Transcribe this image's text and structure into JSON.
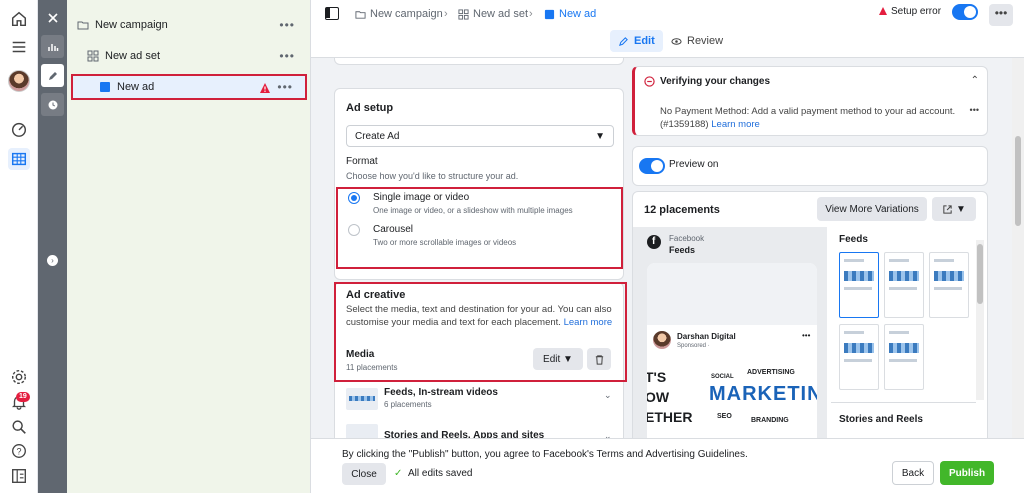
{
  "rail": {
    "icons": [
      "home-icon",
      "menu-icon",
      "avatar",
      "dashboard-icon",
      "table-icon",
      "settings-icon",
      "bell-icon",
      "search-icon",
      "help-icon",
      "panel-icon"
    ],
    "notification_count": "19"
  },
  "tree": {
    "campaign": "New campaign",
    "adset": "New ad set",
    "ad": "New ad",
    "more": "•••"
  },
  "header": {
    "breadcrumb": [
      "New campaign",
      "New ad set",
      "New ad"
    ],
    "edit_label": "Edit",
    "review_label": "Review",
    "setup_error": "Setup error",
    "more": "•••"
  },
  "ad_setup": {
    "title": "Ad setup",
    "create_select": "Create Ad",
    "format_label": "Format",
    "format_hint": "Choose how you'd like to structure your ad.",
    "options": [
      {
        "label": "Single image or video",
        "desc": "One image or video, or a slideshow with multiple images",
        "selected": true
      },
      {
        "label": "Carousel",
        "desc": "Two or more scrollable images or videos",
        "selected": false
      }
    ]
  },
  "ad_creative": {
    "title": "Ad creative",
    "desc": "Select the media, text and destination for your ad. You can also customise your media and text for each placement.",
    "learn_more": "Learn more",
    "media_label": "Media",
    "media_count": "11 placements",
    "edit_label": "Edit",
    "placements": [
      {
        "name": "Feeds, In-stream videos",
        "count": "6 placements"
      },
      {
        "name": "Stories and Reels, Apps and sites",
        "count": ""
      }
    ]
  },
  "verify": {
    "title": "Verifying your changes",
    "message": "No Payment Method: Add a valid payment method to your ad account. (#1359188)",
    "learn_more": "Learn more"
  },
  "preview": {
    "toggle_label": "Preview on",
    "placements_title": "12 placements",
    "variations_btn": "View More Variations",
    "platform": "Facebook",
    "feed_label": "Feeds",
    "page_name": "Darshan Digital",
    "sponsored": "Sponsored · ",
    "creative_words": [
      "SOCIAL",
      "ADVERTISING",
      "MARKETIN",
      "SEO",
      "BRANDING"
    ],
    "creative_left": [
      "T'S",
      "OW",
      "ETHER"
    ],
    "feeds_heading": "Feeds",
    "stories_heading": "Stories and Reels"
  },
  "footer": {
    "terms_prefix": "By clicking the \"Publish\" button, you agree to Facebook's",
    "terms_link": "Terms and Advertising Guidelines",
    "close_label": "Close",
    "saved_label": "All edits saved",
    "back_label": "Back",
    "publish_label": "Publish"
  },
  "colors": {
    "accent": "#1877f2",
    "error": "#d0203b",
    "publish": "#42b72a"
  }
}
